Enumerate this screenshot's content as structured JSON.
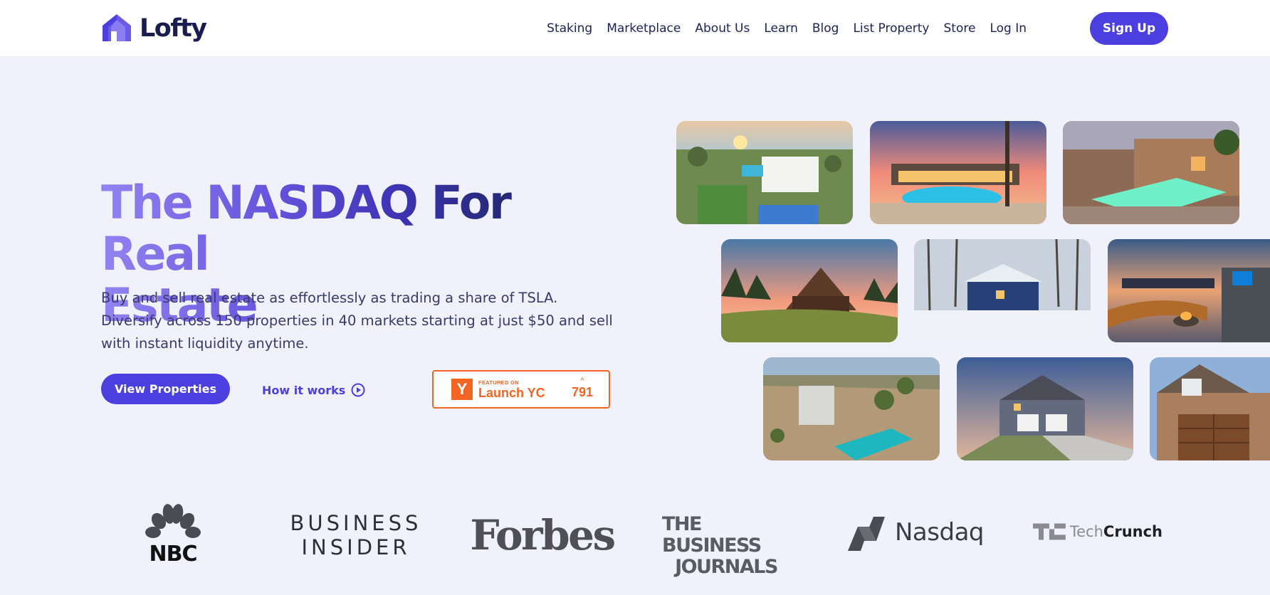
{
  "brand": {
    "name": "Lofty",
    "accent": "#4b3fe0"
  },
  "nav": {
    "items": [
      "Staking",
      "Marketplace",
      "About Us",
      "Learn",
      "Blog",
      "List Property",
      "Store",
      "Log In"
    ],
    "signup": "Sign Up"
  },
  "hero": {
    "title_line1": "The NASDAQ For Real",
    "title_line2": "Estate",
    "subtitle": "Buy and sell real estate as effortlessly as trading a share of TSLA. Diversify across 150 properties in 40 markets starting at just $50 and sell with instant liquidity anytime.",
    "primary_button": "View Properties",
    "secondary_link": "How it works"
  },
  "launch_badge": {
    "featured": "FEATURED ON",
    "label": "Launch YC",
    "logo_letter": "Y",
    "count": "791",
    "color": "#f26522"
  },
  "property_photos": [
    "aerial-house-with-pool-and-sport-court",
    "pool-backyard-at-sunset",
    "adobe-house-with-lit-pool",
    "a-frame-cabin-at-sunset",
    "blue-cabin-in-snow",
    "rooftop-terrace-with-fire-pit",
    "desert-house-with-pool",
    "two-story-suburban-house",
    "brick-house-with-wooden-garage"
  ],
  "press": {
    "nbc": "NBC",
    "business_insider_1": "BUSINESS",
    "business_insider_2": "INSIDER",
    "forbes": "Forbes",
    "bj_1": "THE BUSINESS",
    "bj_2": "JOURNALS",
    "nasdaq": "Nasdaq",
    "tc_1": "Tech",
    "tc_2": "Crunch"
  }
}
